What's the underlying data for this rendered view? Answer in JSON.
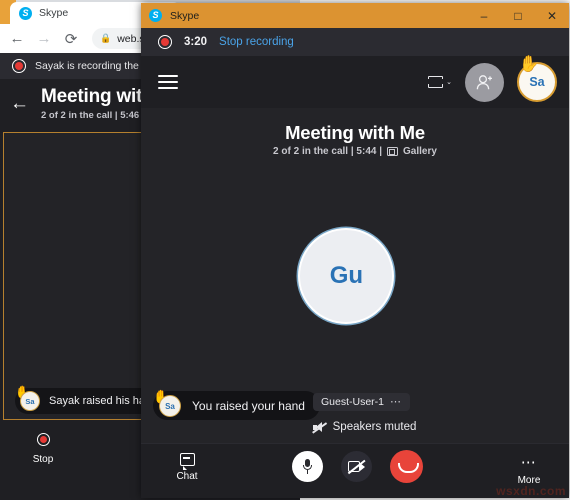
{
  "background_window": {
    "browser": {
      "tab_label": "Skype",
      "tab_icon": "skype-logo-icon",
      "back_icon": "←",
      "forward_icon": "→",
      "reload_icon": "⟳",
      "lock_icon": "🔒",
      "url": "web.skyp"
    },
    "recording_bar": {
      "text": "Sayak is recording the"
    },
    "header": {
      "back_icon": "←",
      "title": "Meeting wit",
      "subtitle": "2 of 2 in the call | 5:46 |"
    },
    "toast": {
      "avatar_initials": "Sa",
      "hand_emoji": "✋",
      "text": "Sayak raised his hand"
    },
    "stop_button": {
      "label": "Stop"
    }
  },
  "foreground_window": {
    "titlebar": {
      "title": "Skype",
      "minimize_label": "–",
      "maximize_label": "□",
      "close_label": "✕"
    },
    "recording_bar": {
      "elapsed": "3:20",
      "stop_link": "Stop recording"
    },
    "topbar": {
      "menu_icon": "hamburger-icon",
      "layout_icon": "gallery-layout-icon",
      "layout_chevron": "⌄",
      "add_person_icon": "add-person-icon",
      "me_avatar_initials": "Sa",
      "me_hand_emoji": "✋"
    },
    "stage": {
      "meeting_title": "Meeting with Me",
      "meeting_subtitle_text": "2 of 2 in the call | 5:44 |",
      "meeting_subtitle_view": "Gallery",
      "participant_avatar_initials": "Gu",
      "toast": {
        "avatar_initials": "Sa",
        "hand_emoji": "✋",
        "text": "You raised your hand"
      },
      "guest_chip": {
        "name": "Guest-User-1",
        "overflow": "⋯"
      },
      "speakers_status": "Speakers muted"
    },
    "controls": {
      "chat_label": "Chat",
      "more_label": "More",
      "more_dots": "⋯",
      "mic_icon": "microphone-icon",
      "camera_icon": "camera-off-icon",
      "hangup_icon": "end-call-icon"
    }
  },
  "watermark": "wsxdn.com",
  "colors": {
    "titlebar_orange": "#dc9331",
    "accent_blue": "#4aa3e8",
    "record_red": "#e53935",
    "hangup_red": "#e8443a",
    "panel_dark": "#1f1f23",
    "stage_dark": "#242428"
  }
}
